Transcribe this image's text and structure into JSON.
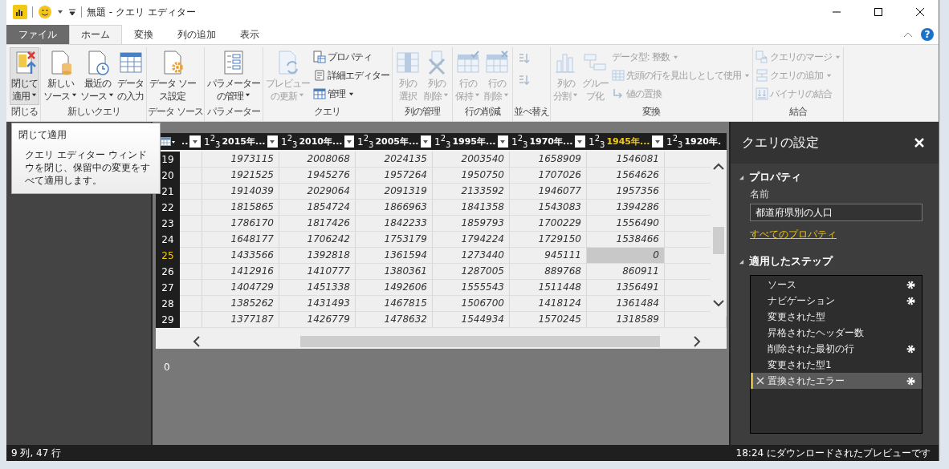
{
  "title_bar": {
    "title": "無題 - クエリ エディター",
    "help_label": "?"
  },
  "ribbon_tabs": [
    {
      "label": "ファイル",
      "kind": "file",
      "selected": false
    },
    {
      "label": "ホーム",
      "kind": "tab",
      "selected": true
    },
    {
      "label": "変換",
      "kind": "tab",
      "selected": false
    },
    {
      "label": "列の追加",
      "kind": "tab",
      "selected": false
    },
    {
      "label": "表示",
      "kind": "tab",
      "selected": false
    }
  ],
  "ribbon_groups": [
    {
      "label": "閉じる",
      "buttons": [
        {
          "kind": "large",
          "lines": [
            "閉じて",
            "適用"
          ],
          "dropdown": true,
          "disabled": false,
          "hovered": true
        }
      ]
    },
    {
      "label": "新しいクエリ",
      "buttons": [
        {
          "kind": "large",
          "lines": [
            "新しい",
            "ソース"
          ],
          "dropdown": true,
          "disabled": false,
          "hovered": false
        },
        {
          "kind": "large",
          "lines": [
            "最近の",
            "ソース"
          ],
          "dropdown": true,
          "disabled": false,
          "hovered": false
        },
        {
          "kind": "large",
          "lines": [
            "データ",
            "の入力"
          ],
          "dropdown": false,
          "disabled": false,
          "hovered": false
        }
      ]
    },
    {
      "label": "データ ソース",
      "buttons": [
        {
          "kind": "large",
          "lines": [
            "データ ソー",
            "ス設定"
          ],
          "dropdown": false,
          "disabled": false,
          "hovered": false
        }
      ]
    },
    {
      "label": "パラメーター",
      "buttons": [
        {
          "kind": "large",
          "lines": [
            "パラメーター",
            "の管理"
          ],
          "dropdown": true,
          "disabled": false,
          "hovered": false
        }
      ]
    },
    {
      "label": "クエリ",
      "buttons": [
        {
          "kind": "large",
          "lines": [
            "プレビュー",
            "の更新"
          ],
          "dropdown": true,
          "disabled": true,
          "hovered": false
        },
        {
          "kind": "small",
          "label": "プロパティ",
          "dropdown": false,
          "disabled": false,
          "hovered": false
        },
        {
          "kind": "small",
          "label": "詳細エディター",
          "dropdown": false,
          "disabled": false,
          "hovered": false
        },
        {
          "kind": "small",
          "label": "管理",
          "dropdown": true,
          "disabled": false,
          "hovered": false
        }
      ]
    },
    {
      "label": "列の管理",
      "buttons": [
        {
          "kind": "large",
          "lines": [
            "列の",
            "選択"
          ],
          "dropdown": false,
          "disabled": true,
          "hovered": false
        },
        {
          "kind": "large",
          "lines": [
            "列の",
            "削除"
          ],
          "dropdown": true,
          "disabled": true,
          "hovered": false
        }
      ]
    },
    {
      "label": "行の削減",
      "buttons": [
        {
          "kind": "large",
          "lines": [
            "行の",
            "保持"
          ],
          "dropdown": true,
          "disabled": true,
          "hovered": false
        },
        {
          "kind": "large",
          "lines": [
            "行の",
            "削除"
          ],
          "dropdown": true,
          "disabled": true,
          "hovered": false
        }
      ]
    },
    {
      "label": "並べ替え",
      "buttons": [
        {
          "kind": "icon",
          "disabled": true,
          "hovered": false
        },
        {
          "kind": "icon",
          "disabled": true,
          "hovered": false
        }
      ]
    },
    {
      "label": "変換",
      "buttons": [
        {
          "kind": "large",
          "lines": [
            "列の",
            "分割"
          ],
          "dropdown": true,
          "disabled": true,
          "hovered": false
        },
        {
          "kind": "large",
          "lines": [
            "グルー",
            "プ化"
          ],
          "dropdown": false,
          "disabled": true,
          "hovered": false
        },
        {
          "kind": "small",
          "label": "データ型: 整数",
          "dropdown": true,
          "disabled": true,
          "hovered": false
        },
        {
          "kind": "small",
          "label": "先頭の行を見出しとして使用",
          "dropdown": true,
          "disabled": true,
          "hovered": false
        },
        {
          "kind": "small",
          "label": "値の置換",
          "dropdown": false,
          "disabled": true,
          "hovered": false
        }
      ]
    },
    {
      "label": "結合",
      "buttons": [
        {
          "kind": "small",
          "label": "クエリのマージ",
          "dropdown": true,
          "disabled": true,
          "hovered": false
        },
        {
          "kind": "small",
          "label": "クエリの追加",
          "dropdown": true,
          "disabled": true,
          "hovered": false
        },
        {
          "kind": "small",
          "label": "バイナリの結合",
          "dropdown": false,
          "disabled": true,
          "hovered": false
        }
      ]
    }
  ],
  "tooltip": {
    "title": "閉じて適用",
    "text": "クエリ エディター ウィンドウを閉じ、保留中の変更をすべて適用します。"
  },
  "table": {
    "columns": [
      {
        "label": "..",
        "filter": true,
        "selected": false
      },
      {
        "label": "2015年...",
        "type_label": "1$^{2}$$_{3}$",
        "filter": true,
        "selected": false
      },
      {
        "label": "2010年...",
        "type_label": "1$^{2}$$_{3}$",
        "filter": true,
        "selected": false
      },
      {
        "label": "2005年...",
        "type_label": "1$^{2}$$_{3}$",
        "filter": true,
        "selected": false
      },
      {
        "label": "1995年...",
        "type_label": "1$^{2}$$_{3}$",
        "filter": true,
        "selected": false
      },
      {
        "label": "1970年...",
        "type_label": "1$^{2}$$_{3}$",
        "filter": true,
        "selected": false
      },
      {
        "label": "1945年...",
        "type_label": "1$^{2}$$_{3}$",
        "filter": true,
        "selected": true
      },
      {
        "label": "1920年.",
        "type_label": "1$^{2}$$_{3}$",
        "filter": false,
        "selected": false
      }
    ],
    "rows": [
      {
        "number": "19",
        "selected": false,
        "cells": [
          {
            "selected": false
          },
          {
            "value": "1973115",
            "selected": false
          },
          {
            "value": "2008068",
            "selected": false
          },
          {
            "value": "2024135",
            "selected": false
          },
          {
            "value": "2003540",
            "selected": false
          },
          {
            "value": "1658909",
            "selected": false
          },
          {
            "value": "1546081",
            "selected": false
          }
        ]
      },
      {
        "number": "20",
        "selected": false,
        "cells": [
          {
            "selected": false
          },
          {
            "value": "1921525",
            "selected": false
          },
          {
            "value": "1945276",
            "selected": false
          },
          {
            "value": "1957264",
            "selected": false
          },
          {
            "value": "1950750",
            "selected": false
          },
          {
            "value": "1707026",
            "selected": false
          },
          {
            "value": "1564626",
            "selected": false
          }
        ]
      },
      {
        "number": "21",
        "selected": false,
        "cells": [
          {
            "selected": false
          },
          {
            "value": "1914039",
            "selected": false
          },
          {
            "value": "2029064",
            "selected": false
          },
          {
            "value": "2091319",
            "selected": false
          },
          {
            "value": "2133592",
            "selected": false
          },
          {
            "value": "1946077",
            "selected": false
          },
          {
            "value": "1957356",
            "selected": false
          }
        ]
      },
      {
        "number": "22",
        "selected": false,
        "cells": [
          {
            "selected": false
          },
          {
            "value": "1815865",
            "selected": false
          },
          {
            "value": "1854724",
            "selected": false
          },
          {
            "value": "1866963",
            "selected": false
          },
          {
            "value": "1841358",
            "selected": false
          },
          {
            "value": "1543083",
            "selected": false
          },
          {
            "value": "1394286",
            "selected": false
          }
        ]
      },
      {
        "number": "23",
        "selected": false,
        "cells": [
          {
            "selected": false
          },
          {
            "value": "1786170",
            "selected": false
          },
          {
            "value": "1817426",
            "selected": false
          },
          {
            "value": "1842233",
            "selected": false
          },
          {
            "value": "1859793",
            "selected": false
          },
          {
            "value": "1700229",
            "selected": false
          },
          {
            "value": "1556490",
            "selected": false
          }
        ]
      },
      {
        "number": "24",
        "selected": false,
        "cells": [
          {
            "selected": false
          },
          {
            "value": "1648177",
            "selected": false
          },
          {
            "value": "1706242",
            "selected": false
          },
          {
            "value": "1753179",
            "selected": false
          },
          {
            "value": "1794224",
            "selected": false
          },
          {
            "value": "1729150",
            "selected": false
          },
          {
            "value": "1538466",
            "selected": false
          }
        ]
      },
      {
        "number": "25",
        "selected": true,
        "cells": [
          {
            "selected": false
          },
          {
            "value": "1433566",
            "selected": false
          },
          {
            "value": "1392818",
            "selected": false
          },
          {
            "value": "1361594",
            "selected": false
          },
          {
            "value": "1273440",
            "selected": false
          },
          {
            "value": "945111",
            "selected": false
          },
          {
            "value": "0",
            "selected": true
          }
        ]
      },
      {
        "number": "26",
        "selected": false,
        "cells": [
          {
            "selected": false
          },
          {
            "value": "1412916",
            "selected": false
          },
          {
            "value": "1410777",
            "selected": false
          },
          {
            "value": "1380361",
            "selected": false
          },
          {
            "value": "1287005",
            "selected": false
          },
          {
            "value": "889768",
            "selected": false
          },
          {
            "value": "860911",
            "selected": false
          }
        ]
      },
      {
        "number": "27",
        "selected": false,
        "cells": [
          {
            "selected": false
          },
          {
            "value": "1404729",
            "selected": false
          },
          {
            "value": "1451338",
            "selected": false
          },
          {
            "value": "1492606",
            "selected": false
          },
          {
            "value": "1555543",
            "selected": false
          },
          {
            "value": "1511448",
            "selected": false
          },
          {
            "value": "1356491",
            "selected": false
          }
        ]
      },
      {
        "number": "28",
        "selected": false,
        "cells": [
          {
            "selected": false
          },
          {
            "value": "1385262",
            "selected": false
          },
          {
            "value": "1431493",
            "selected": false
          },
          {
            "value": "1467815",
            "selected": false
          },
          {
            "value": "1506700",
            "selected": false
          },
          {
            "value": "1418124",
            "selected": false
          },
          {
            "value": "1361484",
            "selected": false
          }
        ]
      },
      {
        "number": "29",
        "selected": false,
        "cells": [
          {
            "selected": false
          },
          {
            "value": "1377187",
            "selected": false
          },
          {
            "value": "1426779",
            "selected": false
          },
          {
            "value": "1478632",
            "selected": false
          },
          {
            "value": "1544934",
            "selected": false
          },
          {
            "value": "1570245",
            "selected": false
          },
          {
            "value": "1318589",
            "selected": false
          }
        ]
      }
    ]
  },
  "cell_preview": "0",
  "query_settings": {
    "title": "クエリの設定",
    "properties": {
      "heading": "プロパティ",
      "expanded": true,
      "name_label": "名前",
      "name_value": "都道府県別の人口",
      "link": "すべてのプロパティ"
    },
    "steps": {
      "heading": "適用したステップ",
      "expanded": true,
      "items": [
        {
          "label": "ソース",
          "settings": true,
          "selected": false
        },
        {
          "label": "ナビゲーション",
          "settings": true,
          "selected": false
        },
        {
          "label": "変更された型",
          "settings": false,
          "selected": false
        },
        {
          "label": "昇格されたヘッダー数",
          "settings": false,
          "selected": false
        },
        {
          "label": "削除された最初の行",
          "settings": true,
          "selected": false
        },
        {
          "label": "変更された型1",
          "settings": false,
          "selected": false
        },
        {
          "label": "置換されたエラー",
          "settings": true,
          "selected": true
        }
      ]
    }
  },
  "status_bar": {
    "left": "9 列, 47 行",
    "right": "18:24 にダウンロードされたプレビューです"
  }
}
